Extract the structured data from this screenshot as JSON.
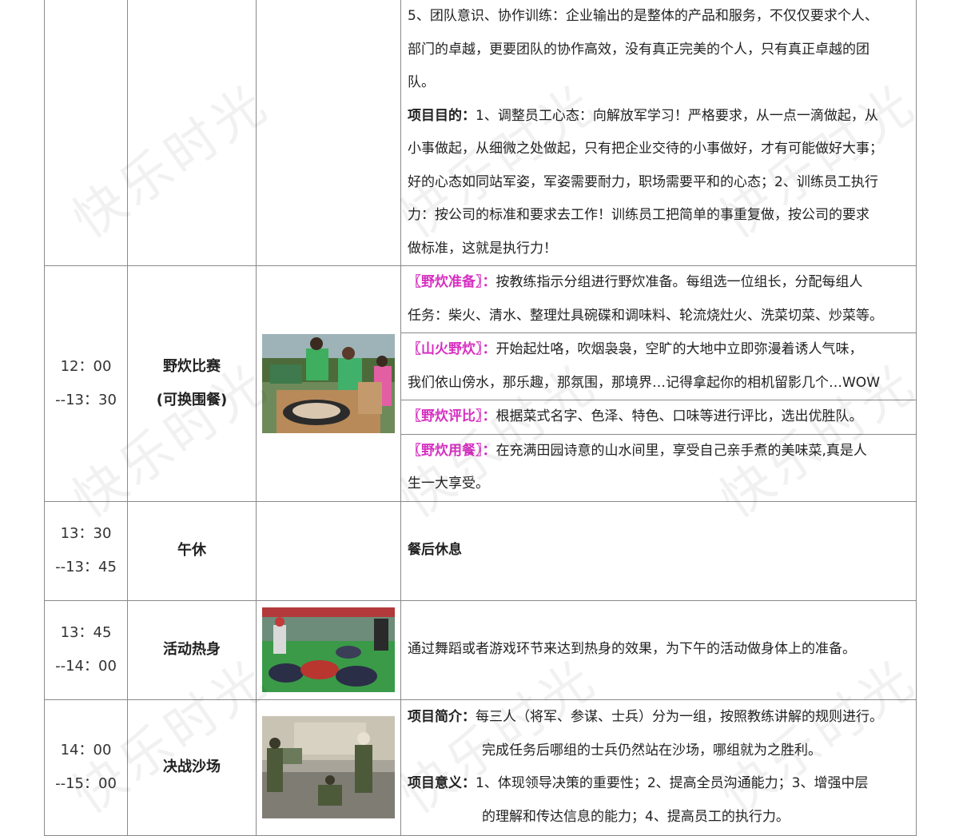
{
  "watermark": "快乐时光",
  "rows": [
    {
      "lines": [
        "5、团队意识、协作训练：企业输出的是整体的产品和服务，不仅仅要求个人、",
        "部门的卓越，更要团队的协作高效，没有真正完美的个人，只有真正卓越的团",
        "队。"
      ],
      "purpose_label": "项目目的：",
      "purpose_lines": [
        "1、调整员工心态：向解放军学习！严格要求，从一点一滴做起，从",
        "小事做起，从细微之处做起，只有把企业交待的小事做好，才有可能做好大事；",
        "好的心态如同站军姿，军姿需要耐力，职场需要平和的心态；2、训练员工执行",
        "力：按公司的标准和要求去工作！训练员工把简单的事重复做，按公司的要求",
        "做标准，这就是执行力！"
      ]
    },
    {
      "time_start": "12：00",
      "time_end": "--13：30",
      "activity": "野炊比赛",
      "activity_note": "(可换围餐)",
      "image_alt": "野炊比赛照片",
      "sections": [
        {
          "label": "〖野炊准备〗：",
          "lines": [
            "按教练指示分组进行野炊准备。每组选一位组长，分配每组人",
            "任务：柴火、清水、整理灶具碗碟和调味料、轮流烧灶火、洗菜切菜、炒菜等。"
          ]
        },
        {
          "label": "〖山火野炊〗：",
          "lines": [
            "开始起灶咯，吹烟袅袅，空旷的大地中立即弥漫着诱人气味，",
            "我们依山傍水，那乐趣，那氛围，那境界…记得拿起你的相机留影几个…WOW"
          ]
        },
        {
          "label": "〖野炊评比〗：",
          "lines": [
            "根据菜式名字、色泽、特色、口味等进行评比，选出优胜队。"
          ]
        },
        {
          "label": "〖野炊用餐〗：",
          "lines": [
            "在充满田园诗意的山水间里，享受自己亲手煮的美味菜,真是人",
            "生一大享受。"
          ]
        }
      ]
    },
    {
      "time_start": "13：30",
      "time_end": "--13：45",
      "activity": "午休",
      "description": "餐后休息"
    },
    {
      "time_start": "13：45",
      "time_end": "--14：00",
      "activity": "活动热身",
      "image_alt": "活动热身照片",
      "description": "通过舞蹈或者游戏环节来达到热身的效果，为下午的活动做身体上的准备。"
    },
    {
      "time_start": "14：00",
      "time_end": "--15：00",
      "activity": "决战沙场",
      "image_alt": "决战沙场照片",
      "intro_label": "项目简介：",
      "intro_lines": [
        "每三人（将军、参谋、士兵）分为一组，按照教练讲解的规则进行。",
        "完成任务后哪组的士兵仍然站在沙场，哪组就为之胜利。"
      ],
      "meaning_label": "项目意义：",
      "meaning_lines": [
        "1、体现领导决策的重要性；2、提高全员沟通能力；3、增强中层",
        "的理解和传达信息的能力；4、提高员工的执行力。"
      ]
    }
  ]
}
